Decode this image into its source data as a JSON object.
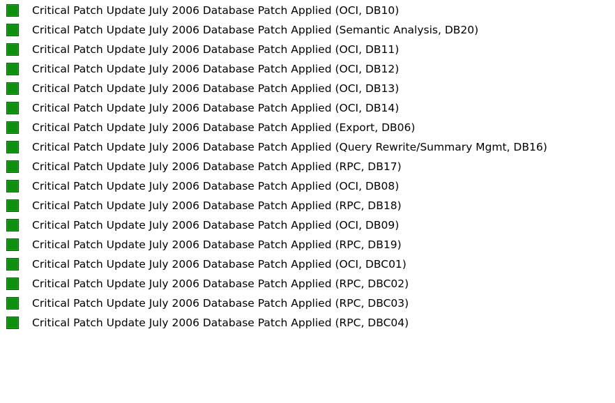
{
  "status_color": "#0f8f0f",
  "status_icon": "green-square-icon",
  "items": [
    {
      "label": "Critical Patch Update July 2006 Database Patch Applied (OCI, DB10)"
    },
    {
      "label": "Critical Patch Update July 2006 Database Patch Applied (Semantic Analysis, DB20)"
    },
    {
      "label": "Critical Patch Update July 2006 Database Patch Applied (OCI, DB11)"
    },
    {
      "label": "Critical Patch Update July 2006 Database Patch Applied (OCI, DB12)"
    },
    {
      "label": "Critical Patch Update July 2006 Database Patch Applied (OCI, DB13)"
    },
    {
      "label": "Critical Patch Update July 2006 Database Patch Applied (OCI, DB14)"
    },
    {
      "label": "Critical Patch Update July 2006 Database Patch Applied (Export, DB06)"
    },
    {
      "label": "Critical Patch Update July 2006 Database Patch Applied (Query Rewrite/Summary Mgmt, DB16)"
    },
    {
      "label": "Critical Patch Update July 2006 Database Patch Applied (RPC, DB17)"
    },
    {
      "label": "Critical Patch Update July 2006 Database Patch Applied (OCI, DB08)"
    },
    {
      "label": "Critical Patch Update July 2006 Database Patch Applied (RPC, DB18)"
    },
    {
      "label": "Critical Patch Update July 2006 Database Patch Applied (OCI, DB09)"
    },
    {
      "label": "Critical Patch Update July 2006 Database Patch Applied (RPC, DB19)"
    },
    {
      "label": "Critical Patch Update July 2006 Database Patch Applied (OCI, DBC01)"
    },
    {
      "label": "Critical Patch Update July 2006 Database Patch Applied (RPC, DBC02)"
    },
    {
      "label": "Critical Patch Update July 2006 Database Patch Applied (RPC, DBC03)"
    },
    {
      "label": "Critical Patch Update July 2006 Database Patch Applied (RPC, DBC04)"
    }
  ]
}
